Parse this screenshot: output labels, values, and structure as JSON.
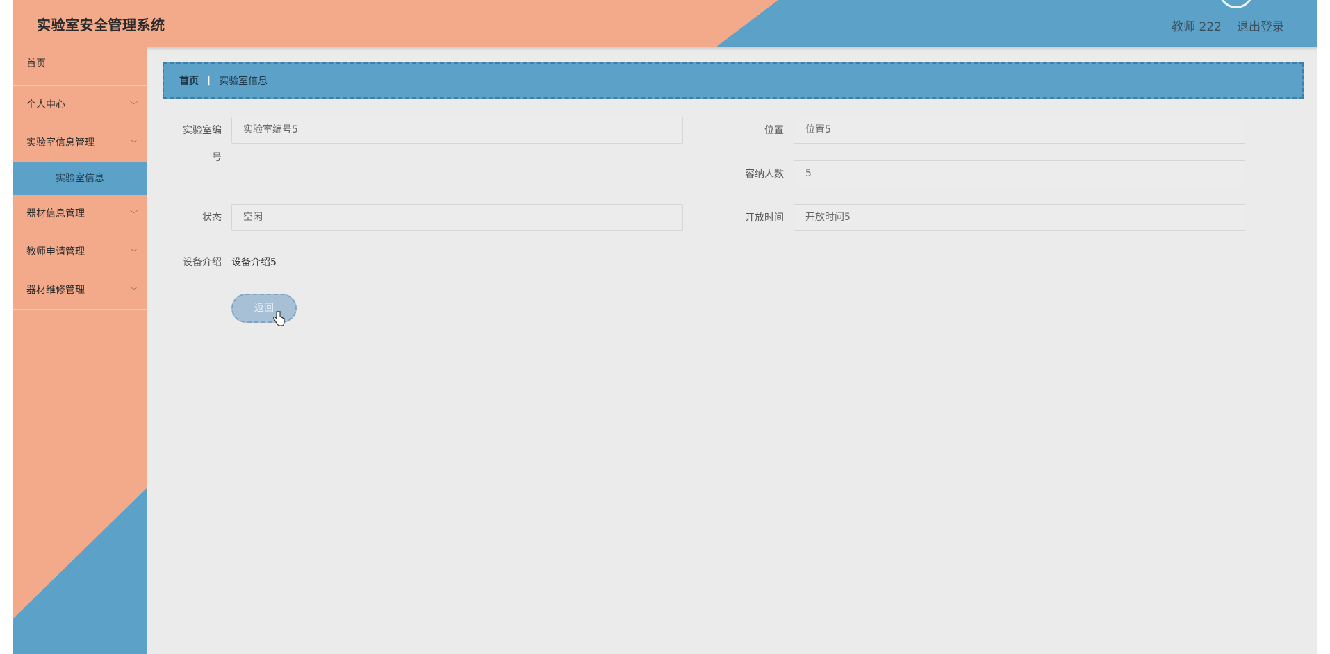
{
  "header": {
    "title": "实验室安全管理系统",
    "user_label": "教师 222",
    "logout_label": "退出登录"
  },
  "sidebar": {
    "items": [
      {
        "label": "首页"
      },
      {
        "label": "个人中心"
      },
      {
        "label": "实验室信息管理"
      },
      {
        "label": "器材信息管理"
      },
      {
        "label": "教师申请管理"
      },
      {
        "label": "器材维修管理"
      }
    ],
    "active_sub": {
      "label": "实验室信息"
    }
  },
  "breadcrumb": {
    "home": "首页",
    "separator": "|",
    "current": "实验室信息"
  },
  "form": {
    "lab_number": {
      "label_line1": "实验室编",
      "label_line2": "号",
      "value": "实验室编号5"
    },
    "location": {
      "label": "位置",
      "value": "位置5"
    },
    "capacity": {
      "label": "容纳人数",
      "value": "5"
    },
    "status": {
      "label": "状态",
      "value": "空闲"
    },
    "open_time": {
      "label": "开放时间",
      "value": "开放时间5"
    },
    "intro": {
      "label": "设备介绍",
      "value": "设备介绍5"
    },
    "back_label": "返回"
  },
  "colors": {
    "accent_blue": "#5ba1c8",
    "accent_salmon": "#f3aa8b",
    "background": "#ebebeb"
  }
}
